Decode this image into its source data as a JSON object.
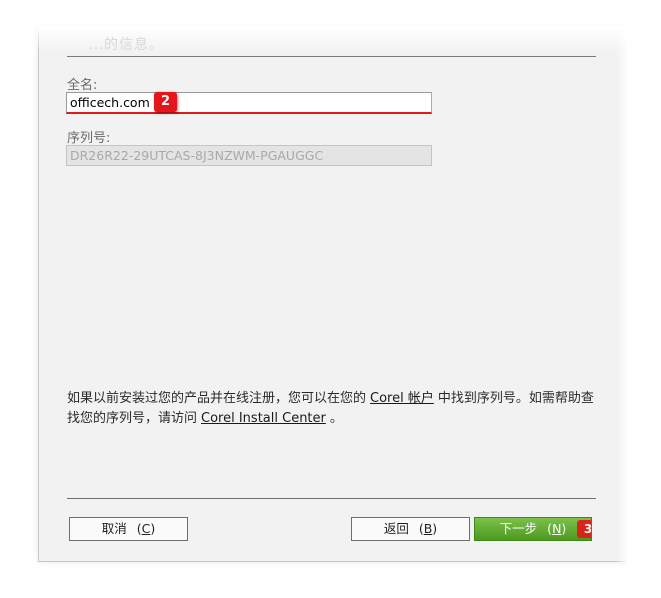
{
  "header": {
    "faded_title": "…的信息。"
  },
  "form": {
    "fullname_label": "全名:",
    "fullname_value": "officech.com",
    "serial_label": "序列号:",
    "serial_value": "DR26R22-29UTCAS-8J3NZWM-PGAUGGC"
  },
  "badges": {
    "step2": "2",
    "step3": "3"
  },
  "info": {
    "text_before": "如果以前安装过您的产品并在线注册，您可以在您的",
    "link_account": "Corel 帐户",
    "text_middle": "中找到序列号。如需帮助查找您的序列号，请访问",
    "link_install_center": "Corel Install Center",
    "text_end": "。"
  },
  "buttons": {
    "cancel_label": "取消",
    "cancel_key": "C",
    "back_label": "返回",
    "back_key": "B",
    "next_label": "下一步",
    "next_key": "N"
  },
  "colors": {
    "accent_red": "#e4161b",
    "next_green": "#5aa82b"
  }
}
